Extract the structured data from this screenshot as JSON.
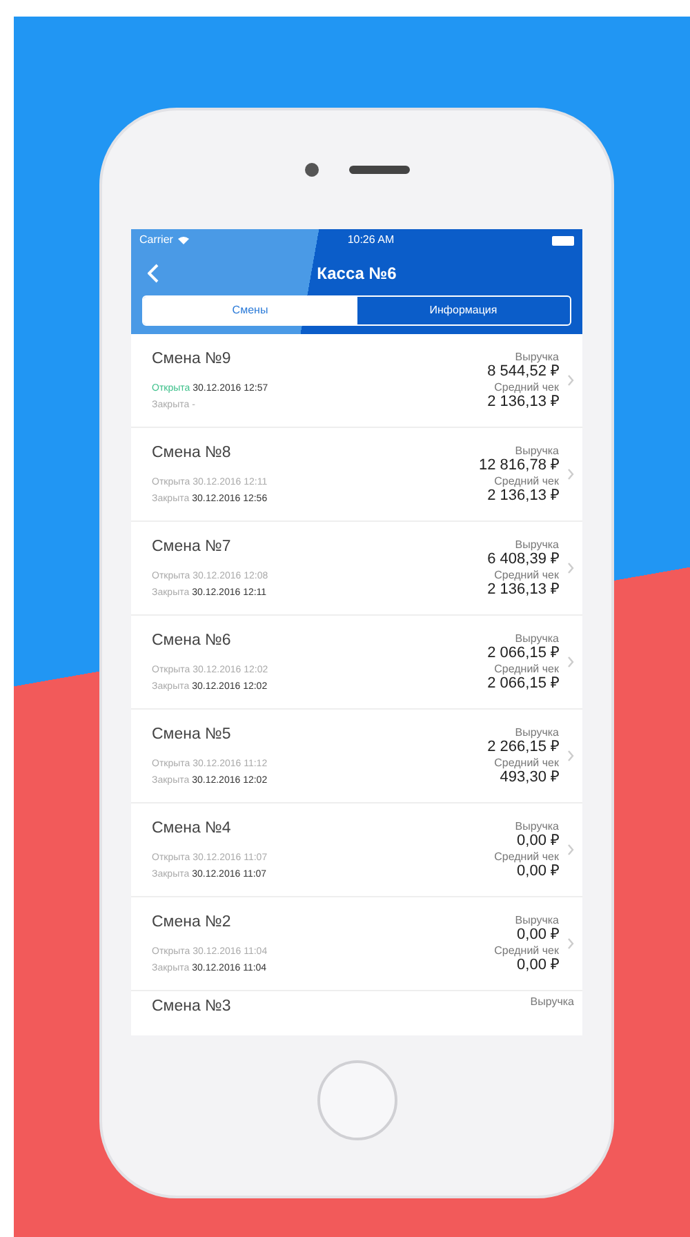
{
  "status_bar": {
    "carrier": "Carrier",
    "time": "10:26 AM"
  },
  "nav": {
    "title": "Касса №6"
  },
  "tabs": [
    {
      "label": "Смены",
      "selected": true
    },
    {
      "label": "Информация",
      "selected": false
    }
  ],
  "shifts": [
    {
      "title": "Смена №9",
      "open": true,
      "opened_label": "Открыта",
      "opened_time": "30.12.2016 12:57",
      "closed_label": "Закрыта",
      "closed_time": "-",
      "revenue_label": "Выручка",
      "revenue": "8 544,52 ₽",
      "avg_label": "Средний чек",
      "avg": "2 136,13 ₽"
    },
    {
      "title": "Смена №8",
      "open": false,
      "opened_label": "Открыта",
      "opened_time": "30.12.2016 12:11",
      "closed_label": "Закрыта",
      "closed_time": "30.12.2016 12:56",
      "revenue_label": "Выручка",
      "revenue": "12 816,78 ₽",
      "avg_label": "Средний чек",
      "avg": "2 136,13 ₽"
    },
    {
      "title": "Смена №7",
      "open": false,
      "opened_label": "Открыта",
      "opened_time": "30.12.2016 12:08",
      "closed_label": "Закрыта",
      "closed_time": "30.12.2016 12:11",
      "revenue_label": "Выручка",
      "revenue": "6 408,39 ₽",
      "avg_label": "Средний чек",
      "avg": "2 136,13 ₽"
    },
    {
      "title": "Смена №6",
      "open": false,
      "opened_label": "Открыта",
      "opened_time": "30.12.2016 12:02",
      "closed_label": "Закрыта",
      "closed_time": "30.12.2016 12:02",
      "revenue_label": "Выручка",
      "revenue": "2 066,15 ₽",
      "avg_label": "Средний чек",
      "avg": "2 066,15 ₽"
    },
    {
      "title": "Смена №5",
      "open": false,
      "opened_label": "Открыта",
      "opened_time": "30.12.2016 11:12",
      "closed_label": "Закрыта",
      "closed_time": "30.12.2016 12:02",
      "revenue_label": "Выручка",
      "revenue": "2 266,15 ₽",
      "avg_label": "Средний чек",
      "avg": "493,30 ₽"
    },
    {
      "title": "Смена №4",
      "open": false,
      "opened_label": "Открыта",
      "opened_time": "30.12.2016 11:07",
      "closed_label": "Закрыта",
      "closed_time": "30.12.2016 11:07",
      "revenue_label": "Выручка",
      "revenue": "0,00 ₽",
      "avg_label": "Средний чек",
      "avg": "0,00 ₽"
    },
    {
      "title": "Смена №2",
      "open": false,
      "opened_label": "Открыта",
      "opened_time": "30.12.2016 11:04",
      "closed_label": "Закрыта",
      "closed_time": "30.12.2016 11:04",
      "revenue_label": "Выручка",
      "revenue": "0,00 ₽",
      "avg_label": "Средний чек",
      "avg": "0,00 ₽"
    },
    {
      "title": "Смена №3",
      "revenue_label": "Выручка"
    }
  ]
}
